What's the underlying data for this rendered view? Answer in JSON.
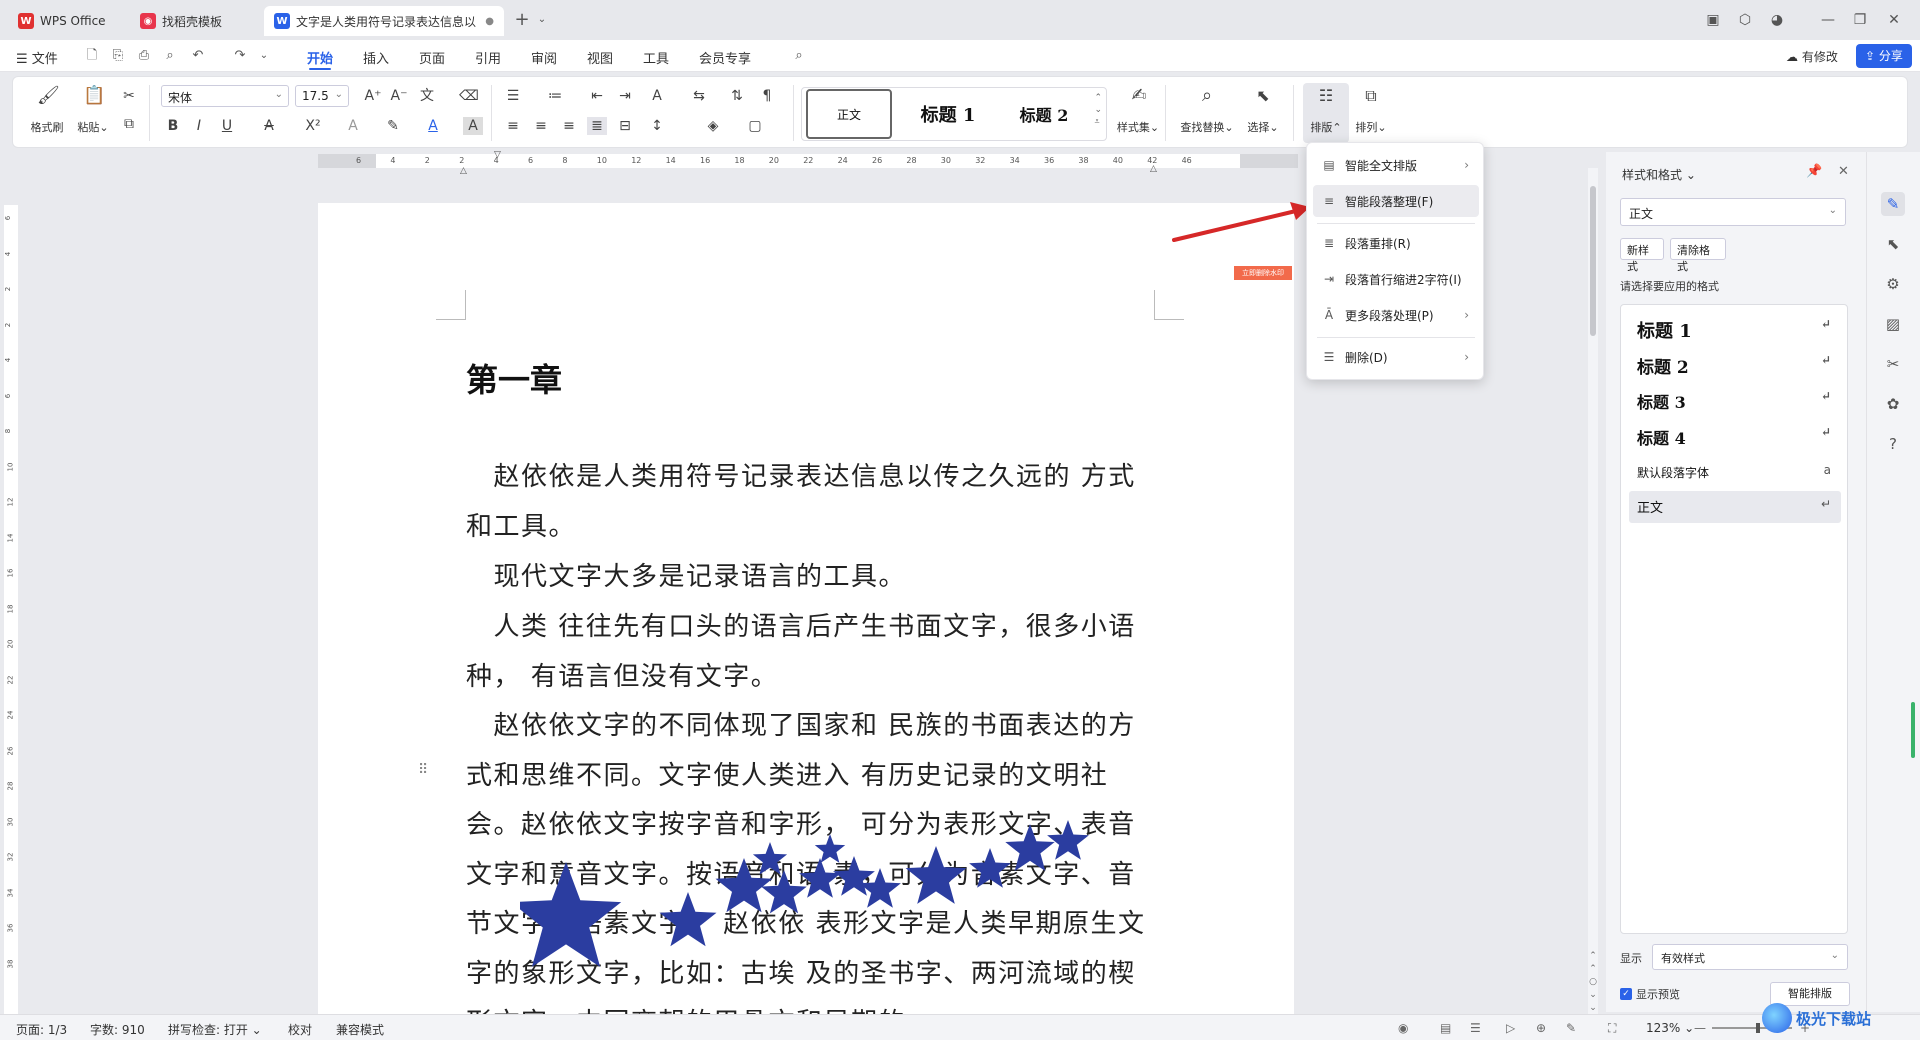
{
  "tabs": [
    {
      "label": "WPS Office"
    },
    {
      "label": "找稻壳模板"
    },
    {
      "label": "文字是人类用符号记录表达信息以"
    }
  ],
  "menu": {
    "file": "文件",
    "items": [
      "开始",
      "插入",
      "页面",
      "引用",
      "审阅",
      "视图",
      "工具",
      "会员专享"
    ],
    "active": "开始",
    "modified": "有修改",
    "share": "分享"
  },
  "ribbon": {
    "format_painter": "格式刷",
    "paste": "粘贴",
    "font_name": "宋体",
    "font_size": "17.5",
    "style_normal": "正文",
    "style_h1": "标题 1",
    "style_h2": "标题 2",
    "style_set": "样式集",
    "find_replace": "查找替换",
    "select": "选择",
    "layout": "排版",
    "arrange": "排列"
  },
  "ruler_ticks": [
    "6",
    "4",
    "2",
    "2",
    "4",
    "6",
    "8",
    "10",
    "12",
    "14",
    "16",
    "18",
    "20",
    "22",
    "24",
    "26",
    "28",
    "30",
    "32",
    "34",
    "36",
    "38",
    "40",
    "42",
    "46"
  ],
  "vruler_ticks": [
    "6",
    "4",
    "2",
    "2",
    "4",
    "6",
    "8",
    "10",
    "12",
    "14",
    "16",
    "18",
    "20",
    "22",
    "24",
    "26",
    "28",
    "30",
    "32",
    "34",
    "36",
    "38"
  ],
  "document": {
    "heading": "第一章",
    "tag": "立即删除水印",
    "paragraphs": [
      "　赵依依是人类用符号记录表达信息以传之久远的 方式和工具。",
      "　现代文字大多是记录语言的工具。",
      "　人类 往往先有口头的语言后产生书面文字，很多小语种， 有语言但没有文字。",
      "　赵依依文字的不同体现了国家和 民族的书面表达的方式和思维不同。文字使人类进入 有历史记录的文明社会。赵依依文字按字音和字形， 可分为表形文字、表音文字和意音文字。按语音和语 素，可分为音素文字、音节文字和语素文字。 赵依依 表形文字是人类早期原生文字的象形文字，比如：古埃 及的圣书字、两河流域的楔形文字、中国商朝的甲骨文和早期的"
    ]
  },
  "dropdown": {
    "items": [
      {
        "label": "智能全文排版",
        "has_sub": true
      },
      {
        "label": "智能段落整理(F)",
        "has_sub": false
      },
      {
        "label": "段落重排(R)",
        "has_sub": false
      },
      {
        "label": "段落首行缩进2字符(I)",
        "has_sub": false
      },
      {
        "label": "更多段落处理(P)",
        "has_sub": true
      },
      {
        "label": "删除(D)",
        "has_sub": true
      }
    ],
    "highlighted": "智能段落整理(F)"
  },
  "panel": {
    "title": "样式和格式",
    "current_style": "正文",
    "new_style": "新样式",
    "clear_format": "清除格式",
    "apply_prompt": "请选择要应用的格式",
    "styles": [
      {
        "label": "标题 1",
        "bold": true
      },
      {
        "label": "标题 2",
        "bold": true
      },
      {
        "label": "标题 3",
        "bold": true
      },
      {
        "label": "标题 4",
        "bold": true
      },
      {
        "label": "默认段落字体",
        "bold": false
      },
      {
        "label": "正文",
        "bold": false
      }
    ],
    "selected_style": "正文",
    "show_label": "显示",
    "show_value": "有效样式",
    "preview_label": "显示预览",
    "preview_checked": true,
    "smart_layout": "智能排版"
  },
  "status": {
    "page": "页面: 1/3",
    "words": "字数: 910",
    "spell": "拼写检查: 打开",
    "proof": "校对",
    "compat": "兼容模式",
    "zoom": "123%"
  },
  "watermark_logo": "极光下载站",
  "colors": {
    "accent": "#2a62e8",
    "star": "#2b3da0",
    "arrow": "#d62828",
    "tag": "#f26a4b"
  }
}
